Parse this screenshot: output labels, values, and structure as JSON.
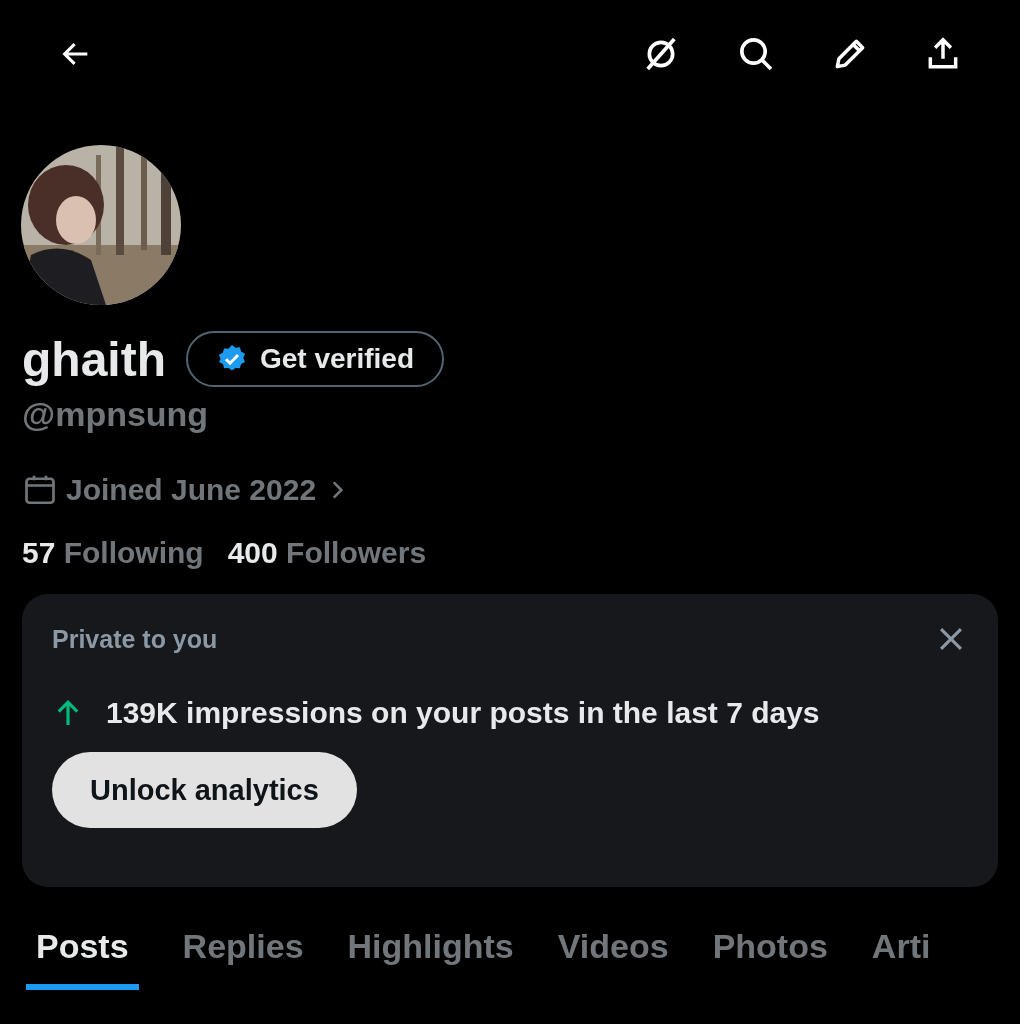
{
  "profile": {
    "name": "ghaith",
    "verify_button": "Get verified",
    "handle": "@mpnsung",
    "joined": "Joined June 2022",
    "stats": [
      {
        "count": "57",
        "label": "Following"
      },
      {
        "count": "400",
        "label": "Followers"
      }
    ]
  },
  "card": {
    "title": "Private to you",
    "message": "139K impressions on your posts in the last 7 days",
    "button": "Unlock analytics"
  },
  "tabs": [
    {
      "label": "Posts",
      "selected": true
    },
    {
      "label": "Replies",
      "selected": false
    },
    {
      "label": "Highlights",
      "selected": false
    },
    {
      "label": "Videos",
      "selected": false
    },
    {
      "label": "Photos",
      "selected": false
    },
    {
      "label": "Arti",
      "selected": false
    }
  ]
}
